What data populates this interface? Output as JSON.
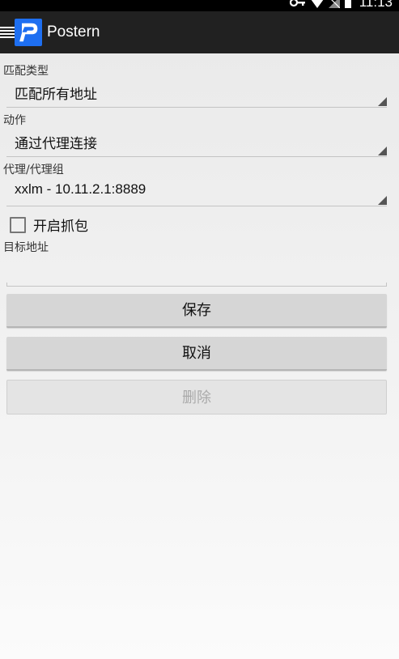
{
  "status_bar": {
    "time": "11:13"
  },
  "action_bar": {
    "logo_letter": "P",
    "title": "Postern"
  },
  "form": {
    "match_type": {
      "label": "匹配类型",
      "value": "匹配所有地址"
    },
    "action": {
      "label": "动作",
      "value": "通过代理连接"
    },
    "proxy": {
      "label": "代理/代理组",
      "value": "xxlm - 10.11.2.1:8889"
    },
    "capture": {
      "label": "开启抓包",
      "checked": false
    },
    "target": {
      "label": "目标地址",
      "value": ""
    }
  },
  "buttons": {
    "save": "保存",
    "cancel": "取消",
    "delete": "删除"
  }
}
